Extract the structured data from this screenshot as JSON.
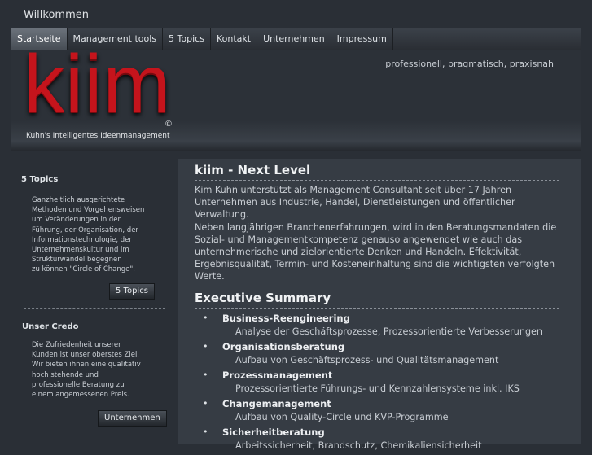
{
  "page_title": "Willkommen",
  "nav": {
    "items": [
      "Startseite",
      "Management tools",
      "5 Topics",
      "Kontakt",
      "Unternehmen",
      "Impressum"
    ],
    "active_index": 0
  },
  "header": {
    "tagline": "professionell, pragmatisch, praxisnah",
    "logo_text": "kiim",
    "logo_copyright": "©",
    "logo_subtitle": "Kuhn's Intelligentes Ideenmanagement"
  },
  "sidebar": {
    "topics": {
      "heading": "5 Topics",
      "lines": [
        "Ganzheitlich ausgerichtete",
        "Methoden und Vorgehensweisen",
        "um Veränderungen in der",
        "Führung, der Organisation, der",
        "Informationstechnologie, der",
        "Unternehmenskultur und im",
        "Strukturwandel begegnen",
        "zu können \"Circle of Change\"."
      ],
      "button": "5 Topics"
    },
    "credo": {
      "heading": "Unser Credo",
      "lines": [
        "Die Zufriedenheit unserer",
        "Kunden ist unser oberstes Ziel.",
        "Wir bieten ihnen eine qualitativ",
        "hoch stehende und",
        "professionelle Beratung zu",
        "einem angemessenen Preis."
      ],
      "button": "Unternehmen"
    }
  },
  "main": {
    "title": "kiim - Next Level",
    "paragraph1": "Kim Kuhn unterstützt als Management Consultant seit über 17 Jahren Unternehmen aus Industrie, Handel, Dienstleistungen und öffentlicher Verwaltung.",
    "paragraph2": "Neben langjährigen Branchenerfahrungen, wird in den Beratungsmandaten die Sozial- und Managementkompetenz genauso angewendet wie auch das unternehmerische und zielorientierte Denken und Handeln. Effektivität, Ergebnisqualität, Termin- und Kosteneinhaltung sind die wichtigsten verfolgten Werte.",
    "summary_title": "Executive Summary",
    "bullet": "•",
    "summary": [
      {
        "title": "Business-Reengineering",
        "desc": "Analyse der Geschäftsprozesse, Prozessorientierte Verbesserungen"
      },
      {
        "title": "Organisationsberatung",
        "desc": "Aufbau von Geschäftsprozess- und Qualitätsmanagement"
      },
      {
        "title": "Prozessmanagement",
        "desc": "Prozessorientierte Führungs- und Kennzahlensysteme inkl. IKS"
      },
      {
        "title": "Changemanagement",
        "desc": "Aufbau von Quality-Circle und KVP-Programme"
      },
      {
        "title": "Sicherheitberatung",
        "desc": "Arbeitssicherheit, Brandschutz, Chemikaliensicherheit"
      }
    ]
  }
}
